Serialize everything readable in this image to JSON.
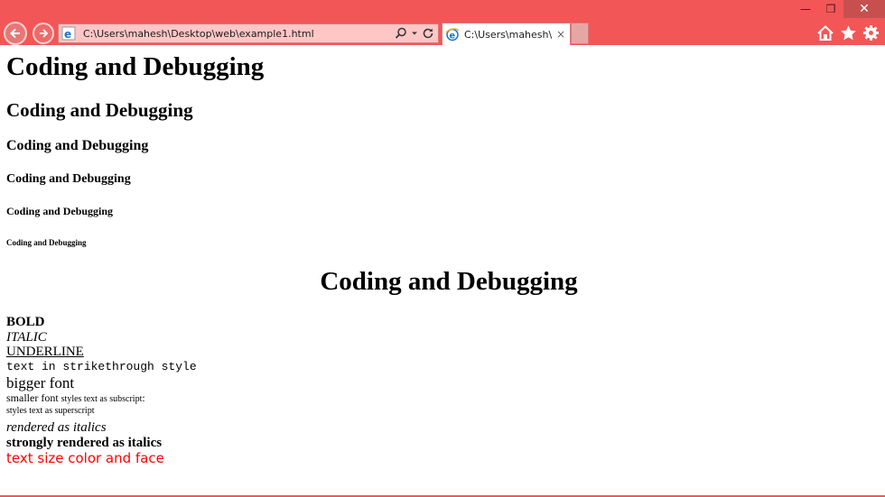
{
  "browser": {
    "address": "C:\\Users\\mahesh\\Desktop\\web\\example1.html",
    "tab_title": "C:\\Users\\mahesh\\D...",
    "tab_close": "×",
    "window_controls": {
      "minimize": "—",
      "maximize": "❐",
      "close": "✕"
    },
    "icons": [
      "back-icon",
      "forward-icon",
      "search-icon",
      "refresh-icon",
      "home-icon",
      "star-icon",
      "gear-icon"
    ],
    "chrome_color": "#f35656"
  },
  "page": {
    "h1": "Coding and Debugging",
    "h2": "Coding and Debugging",
    "h3": "Coding and Debugging",
    "h4": "Coding and Debugging",
    "h5": "Coding and Debugging",
    "h6": "Coding and Debugging",
    "centered_heading": "Coding and Debugging",
    "bold": "BOLD",
    "italic": "ITALIC",
    "underline": "UNDERLINE",
    "strike": "text in strikethrough style",
    "bigger": "bigger font",
    "smaller": "smaller font",
    "subscript_text": "styles text as subscript",
    "subscript_end": ":",
    "superscript": "styles text as superscript",
    "em": "rendered as italics",
    "strong": "strongly rendered as italics",
    "font_text": "text size color and face",
    "font_color": "#ff0000"
  }
}
